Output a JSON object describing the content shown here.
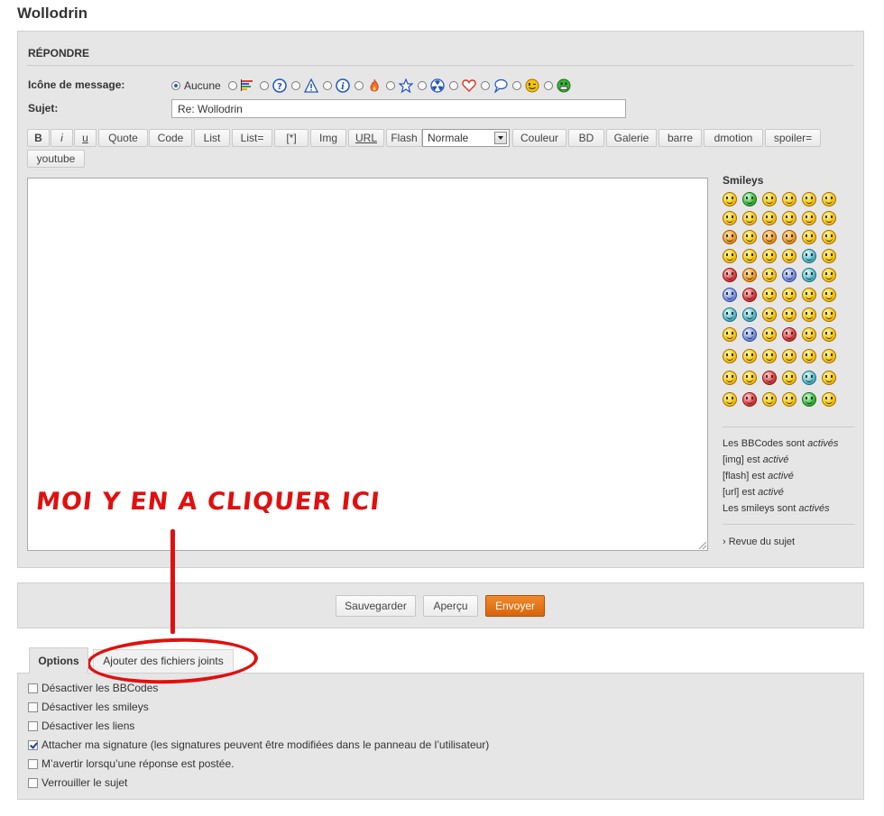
{
  "page": {
    "title": "Wollodrin"
  },
  "reply": {
    "title": "RÉPONDRE",
    "icon_label": "Icône de message:",
    "icon_none_label": "Aucune",
    "subject_label": "Sujet:",
    "subject_value": "Re: Wollodrin"
  },
  "toolbar": {
    "buttons": [
      "B",
      "i",
      "u",
      "Quote",
      "Code",
      "List",
      "List=",
      "[*]",
      "Img",
      "URL",
      "Flash",
      "Couleur",
      "BD",
      "Galerie",
      "barre",
      "dmotion",
      "spoiler=",
      "youtube"
    ],
    "font_size_value": "Normale"
  },
  "smileys": {
    "title": "Smileys"
  },
  "bbcode_status": {
    "bbcodes": "Les BBCodes sont ",
    "bbcodes_state": "activés",
    "img": "[img] est ",
    "img_state": "activé",
    "flash": "[flash] est ",
    "flash_state": "activé",
    "url": "[url] est ",
    "url_state": "activé",
    "smileys": "Les smileys sont ",
    "smileys_state": "activés",
    "review_link": "› Revue du sujet"
  },
  "actions": {
    "save": "Sauvegarder",
    "preview": "Aperçu",
    "send": "Envoyer"
  },
  "tabs": {
    "options": "Options",
    "attachments": "Ajouter des fichiers joints"
  },
  "options": {
    "items": [
      {
        "label": "Désactiver les BBCodes",
        "checked": false
      },
      {
        "label": "Désactiver les smileys",
        "checked": false
      },
      {
        "label": "Désactiver les liens",
        "checked": false
      },
      {
        "label": "Attacher ma signature (les signatures peuvent être modifiées dans le panneau de l’utilisateur)",
        "checked": true
      },
      {
        "label": "M’avertir lorsqu’une réponse est postée.",
        "checked": false
      },
      {
        "label": "Verrouiller le sujet",
        "checked": false
      }
    ]
  },
  "annotation": {
    "text": "MOI Y EN A CLIQUER ICI",
    "color": "#e01010"
  },
  "colors": {
    "accent": "#d9640a",
    "panel_bg": "#e6e6e6"
  }
}
